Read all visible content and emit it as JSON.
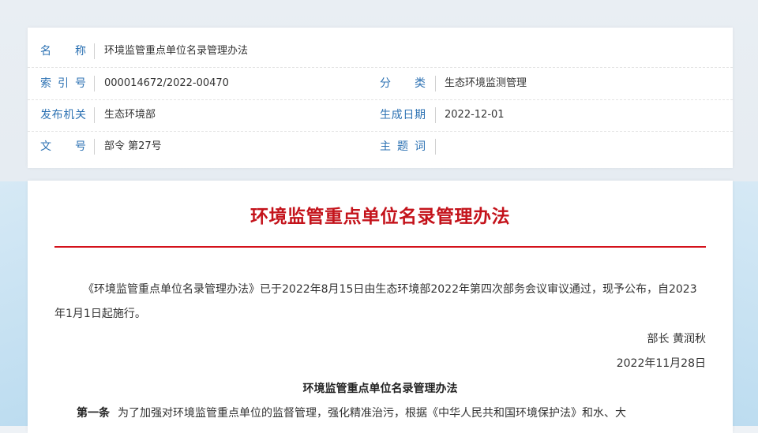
{
  "meta": {
    "rows": [
      {
        "left": {
          "label": "名　　称",
          "value": "环境监管重点单位名录管理办法"
        }
      },
      {
        "left": {
          "label": "索 引 号",
          "value": "000014672/2022-00470"
        },
        "right": {
          "label": "分　　类",
          "value": "生态环境监测管理"
        }
      },
      {
        "left": {
          "label": "发布机关",
          "value": "生态环境部"
        },
        "right": {
          "label": "生成日期",
          "value": "2022-12-01"
        }
      },
      {
        "left": {
          "label": "文　　号",
          "value": "部令 第27号"
        },
        "right": {
          "label": "主 题 词",
          "value": ""
        }
      }
    ]
  },
  "document": {
    "title": "环境监管重点单位名录管理办法",
    "intro": "《环境监管重点单位名录管理办法》已于2022年8月15日由生态环境部2022年第四次部务会议审议通过，现予公布，自2023年1月1日起施行。",
    "signer": "部长 黄润秋",
    "sign_date": "2022年11月28日",
    "subtitle": "环境监管重点单位名录管理办法",
    "article1_no": "第一条",
    "article1_text": "为了加强对环境监管重点单位的监督管理，强化精准治污，根据《中华人民共和国环境保护法》和水、大"
  },
  "colors": {
    "label_blue": "#2d72b3",
    "title_red": "#c4131b",
    "rule_red": "#d4111b"
  }
}
